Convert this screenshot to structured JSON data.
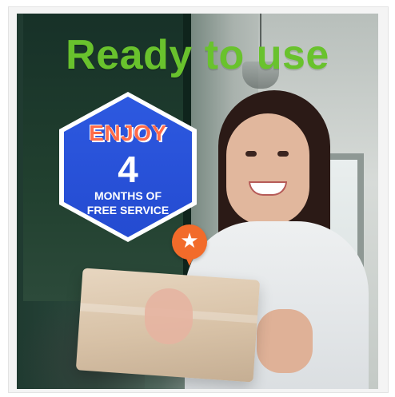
{
  "banner": {
    "headline": "Ready to use",
    "promo": {
      "enjoy": "ENJOY",
      "number": "4",
      "line1": "MONTHS OF",
      "line2": "FREE SERVICE"
    },
    "pin_icon": "location-star-icon"
  },
  "colors": {
    "headline": "#69c22d",
    "hexagon": "#2d59e0",
    "enjoy_text": "#ff6b4a",
    "pin": "#f26b2a"
  }
}
